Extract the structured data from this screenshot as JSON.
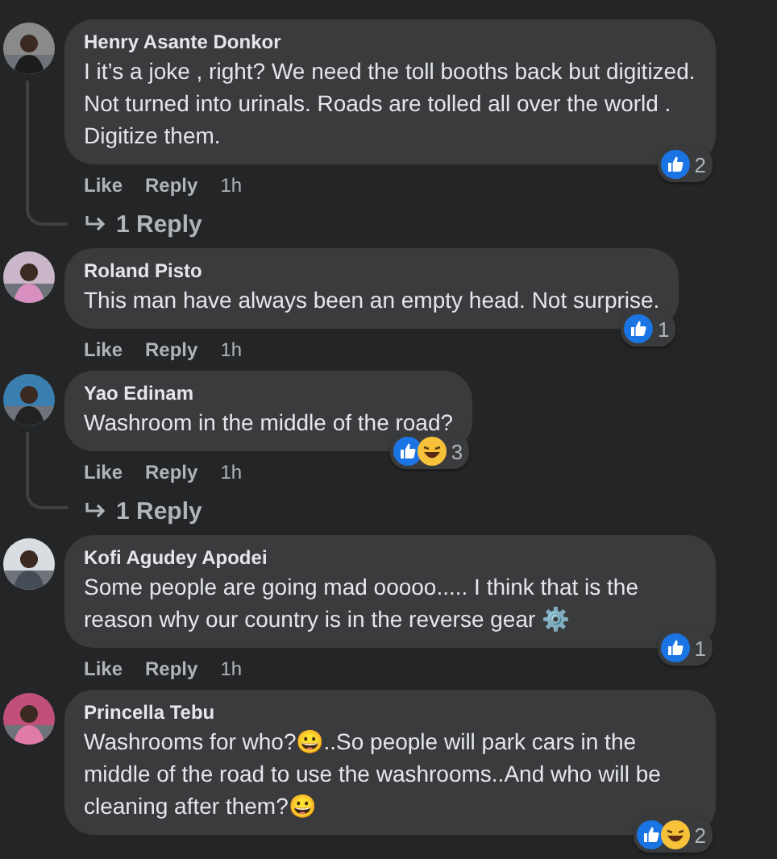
{
  "comments": [
    {
      "name": "Henry Asante Donkor",
      "text": "I it’s a joke , right? We need the toll booths back but digitized. Not turned into urinals. Roads are tolled all over the world . Digitize them.",
      "reactions": [
        {
          "kind": "like"
        }
      ],
      "reaction_count": "2",
      "actions": {
        "like": "Like",
        "reply": "Reply",
        "time": "1h"
      },
      "replies_link": "1 Reply"
    },
    {
      "name": "Roland Pisto",
      "text": "This man have always been an empty head. Not surprise.",
      "reactions": [
        {
          "kind": "like"
        }
      ],
      "reaction_count": "1",
      "actions": {
        "like": "Like",
        "reply": "Reply",
        "time": "1h"
      }
    },
    {
      "name": "Yao Edinam",
      "text": "Washroom in the middle of the road?",
      "reactions": [
        {
          "kind": "like"
        },
        {
          "kind": "haha"
        }
      ],
      "reaction_count": "3",
      "actions": {
        "like": "Like",
        "reply": "Reply",
        "time": "1h"
      },
      "replies_link": "1 Reply"
    },
    {
      "name": "Kofi Agudey Apodei",
      "text": "Some people are going mad ooooo..... I think that is the reason why our country is in the reverse gear ⚙️",
      "reactions": [
        {
          "kind": "like"
        }
      ],
      "reaction_count": "1",
      "actions": {
        "like": "Like",
        "reply": "Reply",
        "time": "1h"
      }
    },
    {
      "name": "Princella Tebu",
      "text": "Washrooms for who?😀..So people will park cars in the middle of the road to use the washrooms..And who will be cleaning after them?😀",
      "reactions": [
        {
          "kind": "like"
        },
        {
          "kind": "haha"
        }
      ],
      "reaction_count": "2"
    }
  ]
}
